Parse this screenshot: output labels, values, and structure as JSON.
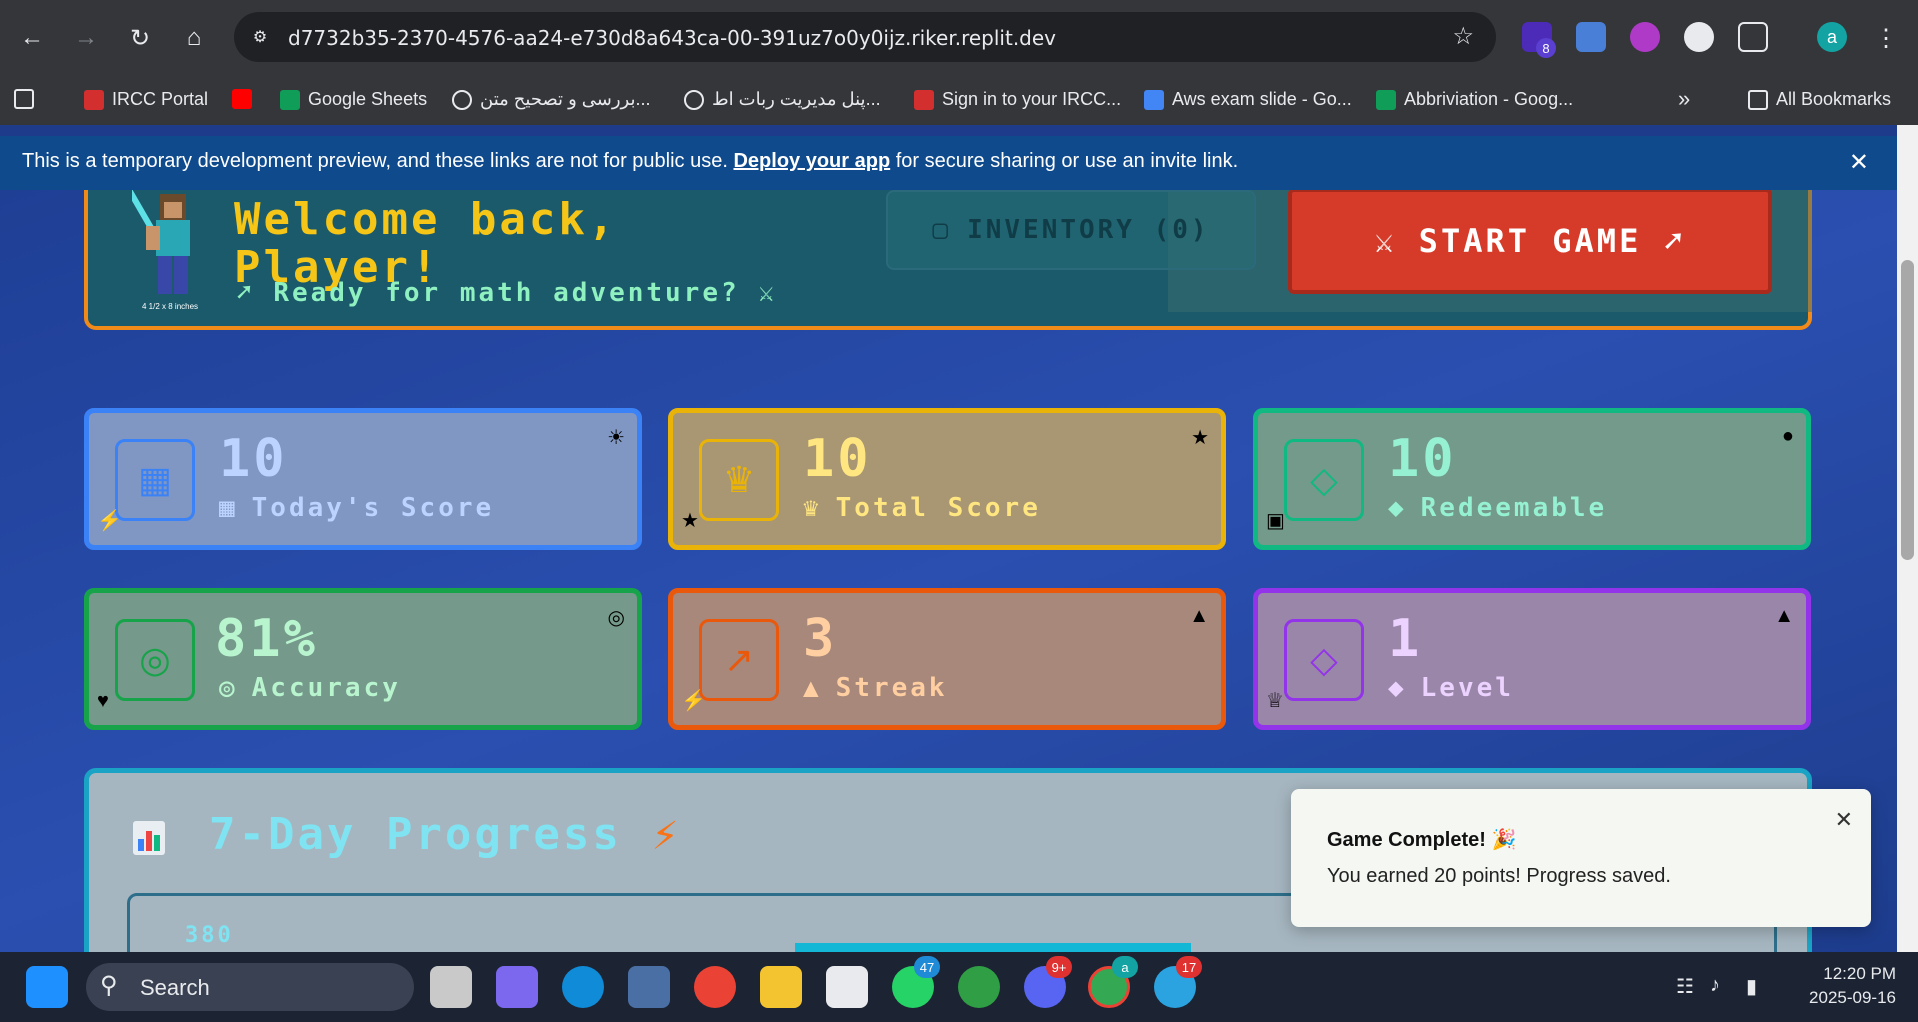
{
  "browser": {
    "url": "d7732b35-2370-4576-aa24-e730d8a643ca-00-391uz7o0y0ijz.riker.replit.dev",
    "profile_initial": "a",
    "extension_badge": "8",
    "bookmarks": [
      {
        "label": "IRCC Portal"
      },
      {
        "label": "Google Sheets"
      },
      {
        "label": "بررسی و تصحیح متن..."
      },
      {
        "label": "پنل مدیریت ربات اط..."
      },
      {
        "label": "Sign in to your IRCC..."
      },
      {
        "label": "Aws exam slide - Go..."
      },
      {
        "label": "Abbriviation - Goog..."
      }
    ],
    "more_bookmarks": "»",
    "all_bookmarks": "All Bookmarks"
  },
  "banner": {
    "text_before": "This is a temporary development preview, and these links are not for public use. ",
    "link": "Deploy your app",
    "text_after": " for secure sharing or use an invite link.",
    "close": "✕"
  },
  "welcome": {
    "title_line1": "Welcome back,",
    "title_line2": "Player!",
    "subtitle": "Ready for math adventure?",
    "hero_caption": "4 1/2 x 8 inches",
    "inventory_label": "INVENTORY (0)",
    "start_label": "START GAME"
  },
  "stats": [
    {
      "value": "10",
      "label": "Today's Score",
      "color": "#3b82f6",
      "bg": "#7f97c2",
      "text": "#bcd2ff"
    },
    {
      "value": "10",
      "label": "Total Score",
      "color": "#eab308",
      "bg": "#a99672",
      "text": "#ffe680"
    },
    {
      "value": "10",
      "label": "Redeemable",
      "color": "#10b981",
      "bg": "#739a8a",
      "text": "#96f0d2"
    },
    {
      "value": "81%",
      "label": "Accuracy",
      "color": "#16a34a",
      "bg": "#75998a",
      "text": "#b8f5cf"
    },
    {
      "value": "3",
      "label": "Streak",
      "color": "#ea580c",
      "bg": "#a7887b",
      "text": "#ffcfa1"
    },
    {
      "value": "1",
      "label": "Level",
      "color": "#9333ea",
      "bg": "#9a86a8",
      "text": "#ecd2ff"
    }
  ],
  "progress": {
    "title": "7-Day Progress",
    "y_tick": "380"
  },
  "toast": {
    "title": "Game Complete! 🎉",
    "message": "You earned 20 points! Progress saved.",
    "close": "✕"
  },
  "taskbar": {
    "search_label": "Search",
    "whatsapp_badge": "47",
    "discord_badge": "9+",
    "telegram_badge": "17",
    "chrome_badge": "a",
    "time": "12:20 PM",
    "date": "2025-09-16"
  }
}
